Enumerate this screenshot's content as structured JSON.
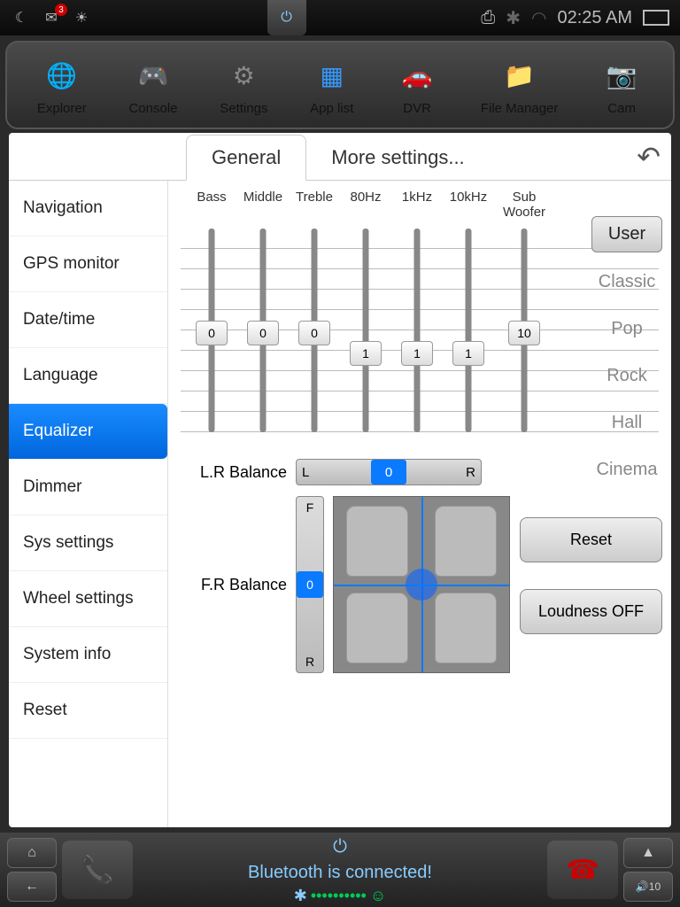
{
  "status": {
    "time": "02:25 AM",
    "notification_count": "3"
  },
  "dock": {
    "items": [
      {
        "label": "Explorer",
        "icon": "🌐"
      },
      {
        "label": "Console",
        "icon": "🎮"
      },
      {
        "label": "Settings",
        "icon": "⚙"
      },
      {
        "label": "App list",
        "icon": "▦"
      },
      {
        "label": "DVR",
        "icon": "🚗"
      },
      {
        "label": "File Manager",
        "icon": "📁"
      },
      {
        "label": "Cam",
        "icon": "📷"
      }
    ]
  },
  "tabs": {
    "general": "General",
    "more": "More settings..."
  },
  "sidebar": {
    "items": [
      "Navigation",
      "GPS monitor",
      "Date/time",
      "Language",
      "Equalizer",
      "Dimmer",
      "Sys settings",
      "Wheel settings",
      "System info",
      "Reset"
    ],
    "active_index": 4
  },
  "eq": {
    "bands": [
      {
        "label": "Bass",
        "value": "0",
        "pos": 45
      },
      {
        "label": "Middle",
        "value": "0",
        "pos": 45
      },
      {
        "label": "Treble",
        "value": "0",
        "pos": 45
      },
      {
        "label": "80Hz",
        "value": "1",
        "pos": 55
      },
      {
        "label": "1kHz",
        "value": "1",
        "pos": 55
      },
      {
        "label": "10kHz",
        "value": "1",
        "pos": 55
      },
      {
        "label": "Sub Woofer",
        "value": "10",
        "pos": 45
      }
    ],
    "presets": [
      "User",
      "Classic",
      "Pop",
      "Rock",
      "Hall",
      "Cinema"
    ],
    "active_preset": 0
  },
  "balance": {
    "lr_label": "L.R Balance",
    "lr_left": "L",
    "lr_right": "R",
    "lr_value": "0",
    "fr_label": "F.R Balance",
    "fr_front": "F",
    "fr_rear": "R",
    "fr_value": "0"
  },
  "buttons": {
    "reset": "Reset",
    "loudness": "Loudness OFF"
  },
  "bottom": {
    "bt_status": "Bluetooth is connected!",
    "volume": "10"
  }
}
